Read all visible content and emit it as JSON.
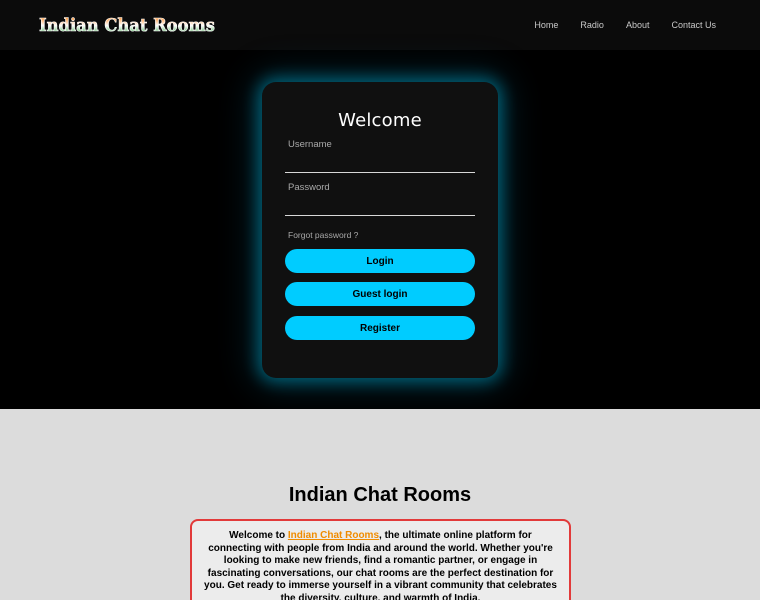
{
  "site": {
    "brand": "Indian Chat Rooms"
  },
  "nav": {
    "items": [
      {
        "label": "Home"
      },
      {
        "label": "Radio"
      },
      {
        "label": "About"
      },
      {
        "label": "Contact Us"
      }
    ]
  },
  "login": {
    "title": "Welcome",
    "username_label": "Username",
    "username_value": "",
    "password_label": "Password",
    "password_value": "",
    "forgot": "Forgot password ?",
    "login_button": "Login",
    "guest_button": "Guest login",
    "register_button": "Register"
  },
  "about": {
    "title": "Indian Chat Rooms",
    "intro_prefix": "Welcome to ",
    "intro_link": "Indian Chat Rooms",
    "intro_body": ", the ultimate online platform for connecting with people from India and around the world. Whether you're looking to make new friends, find a romantic partner, or engage in fascinating conversations, our chat rooms are the perfect destination for you. Get ready to immerse yourself in a vibrant community that celebrates the diversity, culture, and warmth of India."
  },
  "colors": {
    "accent": "#00ccff",
    "navbar": "#0b0b0b",
    "link_orange": "#f08c00",
    "box_border": "#e23a3a"
  }
}
